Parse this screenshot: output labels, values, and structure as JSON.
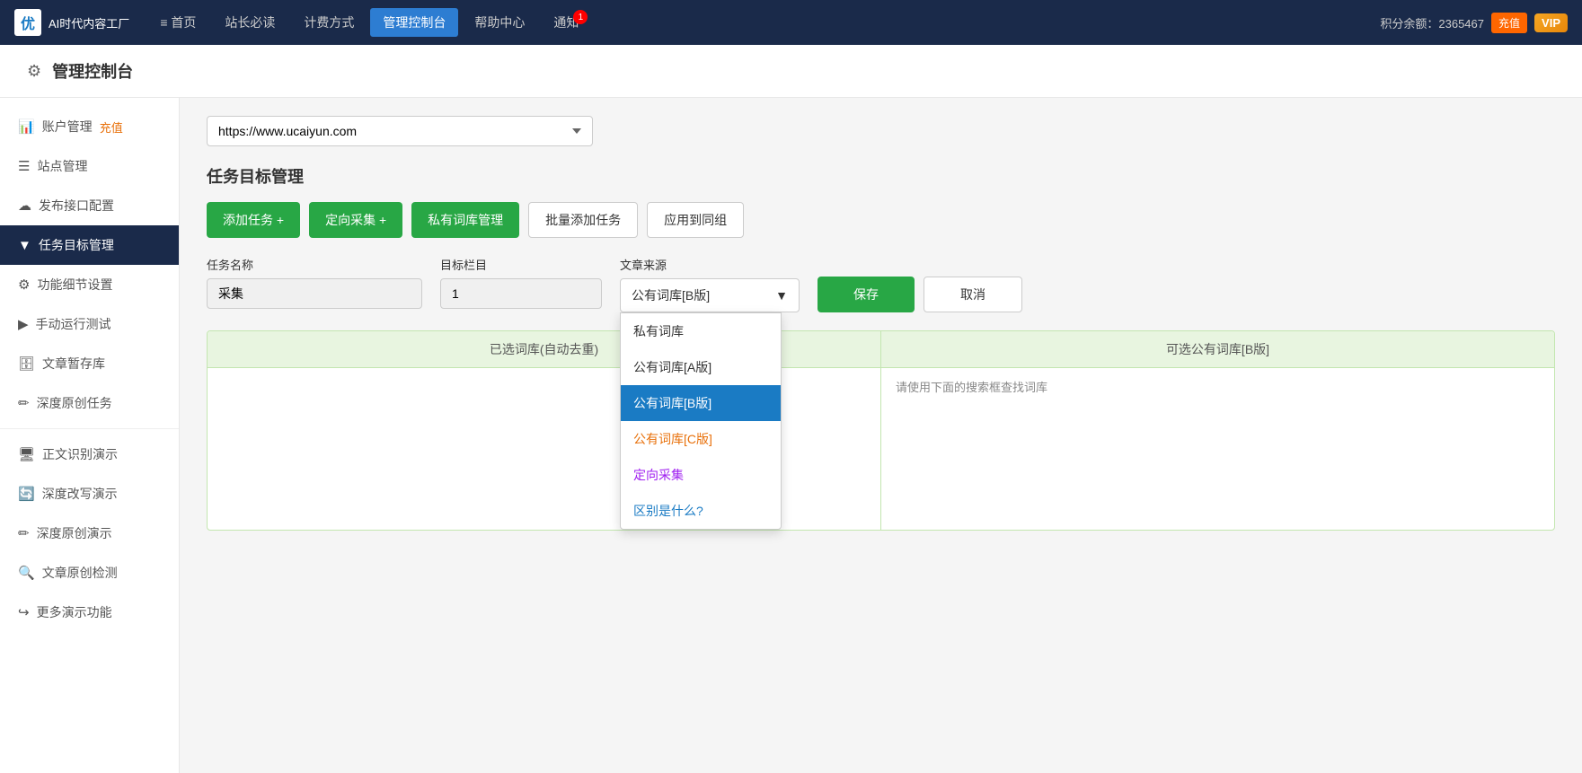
{
  "topNav": {
    "logo": "优采云",
    "logoSub": "AI时代内容工厂",
    "items": [
      {
        "id": "home",
        "label": "≡ 首页",
        "active": false
      },
      {
        "id": "reading",
        "label": "站长必读",
        "active": false
      },
      {
        "id": "pricing",
        "label": "计费方式",
        "active": false
      },
      {
        "id": "dashboard",
        "label": "管理控制台",
        "active": true
      },
      {
        "id": "help",
        "label": "帮助中心",
        "active": false
      },
      {
        "id": "notification",
        "label": "通知",
        "active": false,
        "badge": "1"
      }
    ],
    "points": "积分余额：2365467",
    "rechargeLabel": "充值",
    "vipLabel": "VIP"
  },
  "pageHeader": {
    "icon": "⚙",
    "title": "管理控制台"
  },
  "sidebar": {
    "items": [
      {
        "id": "account",
        "icon": "📊",
        "label": "账户管理",
        "extra": "充值",
        "active": false
      },
      {
        "id": "site",
        "icon": "☰",
        "label": "站点管理",
        "active": false
      },
      {
        "id": "publish",
        "icon": "☁",
        "label": "发布接口配置",
        "active": false
      },
      {
        "id": "task",
        "icon": "▼",
        "label": "任务目标管理",
        "active": true
      },
      {
        "id": "settings",
        "icon": "⚙",
        "label": "功能细节设置",
        "active": false
      },
      {
        "id": "run",
        "icon": "▶",
        "label": "手动运行测试",
        "active": false
      },
      {
        "id": "draft",
        "icon": "🗄",
        "label": "文章暂存库",
        "active": false
      },
      {
        "id": "original",
        "icon": "✏",
        "label": "深度原创任务",
        "active": false
      },
      {
        "id": "demo1",
        "icon": "🖥",
        "label": "正文识别演示",
        "active": false
      },
      {
        "id": "demo2",
        "icon": "🔄",
        "label": "深度改写演示",
        "active": false
      },
      {
        "id": "demo3",
        "icon": "✏",
        "label": "深度原创演示",
        "active": false
      },
      {
        "id": "check",
        "icon": "🔍",
        "label": "文章原创检测",
        "active": false
      },
      {
        "id": "more",
        "icon": "↪",
        "label": "更多演示功能",
        "active": false
      }
    ]
  },
  "main": {
    "urlSelect": {
      "value": "https://www.ucaiyun.com",
      "options": [
        "https://www.ucaiyun.com"
      ]
    },
    "sectionTitle": "任务目标管理",
    "buttons": {
      "addTask": "添加任务 +",
      "directedCollect": "定向采集 +",
      "privateLib": "私有词库管理",
      "batchAdd": "批量添加任务",
      "applyGroup": "应用到同组"
    },
    "form": {
      "taskNameLabel": "任务名称",
      "taskNameValue": "采集",
      "targetColumnLabel": "目标栏目",
      "targetColumnValue": "1",
      "sourceLabel": "文章来源",
      "sourceValue": "公有词库[B版]",
      "saveLabel": "保存",
      "cancelLabel": "取消"
    },
    "dropdown": {
      "options": [
        {
          "id": "private",
          "label": "私有词库",
          "class": ""
        },
        {
          "id": "public-a",
          "label": "公有词库[A版]",
          "class": ""
        },
        {
          "id": "public-b",
          "label": "公有词库[B版]",
          "class": "active"
        },
        {
          "id": "public-c",
          "label": "公有词库[C版]",
          "class": "c-version"
        },
        {
          "id": "directed",
          "label": "定向采集",
          "class": "directed"
        },
        {
          "id": "diff",
          "label": "区别是什么?",
          "class": "diff-link"
        }
      ]
    },
    "selectedLib": {
      "header": "已选词库(自动去重)",
      "hint": ""
    },
    "publicLib": {
      "header": "可选公有词库[B版]",
      "hint": "请使用下面的搜索框查找词库"
    }
  }
}
